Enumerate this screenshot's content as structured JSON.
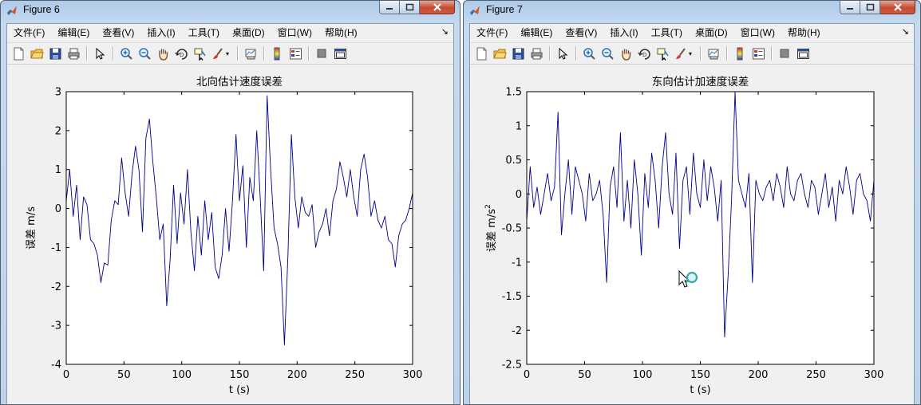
{
  "windows": [
    {
      "title": "Figure 6",
      "menu": [
        "文件(F)",
        "编辑(E)",
        "查看(V)",
        "插入(I)",
        "工具(T)",
        "桌面(D)",
        "窗口(W)",
        "帮助(H)"
      ],
      "menu_overflow_icon": "chevron-icon"
    },
    {
      "title": "Figure 7",
      "menu": [
        "文件(F)",
        "编辑(E)",
        "查看(V)",
        "插入(I)",
        "工具(T)",
        "桌面(D)",
        "窗口(W)",
        "帮助(H)"
      ],
      "menu_overflow_icon": "chevron-icon"
    }
  ],
  "toolbar_icons": [
    "new-figure-icon",
    "open-file-icon",
    "save-icon",
    "print-icon",
    "edit-plot-arrow-icon",
    "zoom-in-icon",
    "zoom-out-icon",
    "pan-hand-icon",
    "rotate-3d-icon",
    "data-cursor-icon",
    "brush-icon",
    "link-plot-icon",
    "colorbar-icon",
    "legend-icon",
    "hide-plot-tools-icon",
    "show-plot-tools-icon"
  ],
  "colors": {
    "line": "#00008b",
    "figure_bg": "#f0f0f0",
    "axes_bg": "#ffffff"
  },
  "chart_data": [
    {
      "type": "line",
      "title": "北向估计速度误差",
      "xlabel": "t (s)",
      "ylabel": "误差 m/s",
      "xlim": [
        0,
        300
      ],
      "ylim": [
        -4,
        3
      ],
      "xticks": [
        "0",
        "50",
        "100",
        "150",
        "200",
        "250",
        "300"
      ],
      "yticks": [
        "-4",
        "-3",
        "-2",
        "-1",
        "0",
        "1",
        "2",
        "3"
      ],
      "grid": false,
      "x": [
        0,
        3,
        6,
        9,
        12,
        15,
        18,
        21,
        24,
        27,
        30,
        33,
        36,
        39,
        42,
        45,
        48,
        51,
        54,
        57,
        60,
        63,
        66,
        69,
        72,
        75,
        78,
        81,
        84,
        87,
        90,
        93,
        96,
        99,
        102,
        105,
        108,
        111,
        114,
        117,
        120,
        123,
        126,
        129,
        132,
        135,
        138,
        141,
        144,
        147,
        150,
        153,
        156,
        159,
        162,
        165,
        168,
        171,
        174,
        177,
        180,
        183,
        186,
        189,
        192,
        195,
        198,
        201,
        204,
        207,
        210,
        213,
        216,
        219,
        222,
        225,
        228,
        231,
        234,
        237,
        240,
        243,
        246,
        249,
        252,
        255,
        258,
        261,
        264,
        267,
        270,
        273,
        276,
        279,
        282,
        285,
        288,
        291,
        294,
        297,
        300
      ],
      "y": [
        0.2,
        1.0,
        -0.2,
        0.6,
        -0.8,
        0.3,
        0.1,
        -0.8,
        -0.9,
        -1.2,
        -1.9,
        -1.4,
        -1.45,
        -0.3,
        0.2,
        0.1,
        1.3,
        0.4,
        -0.2,
        0.9,
        1.6,
        1.0,
        -0.6,
        1.8,
        2.3,
        1.2,
        0.3,
        -0.8,
        -0.4,
        -2.5,
        -1.3,
        0.6,
        -0.9,
        0.4,
        -0.4,
        1.0,
        -0.6,
        -1.6,
        -0.2,
        -1.2,
        0.2,
        -0.8,
        -0.1,
        -1.5,
        -1.8,
        -1.2,
        0.0,
        -1.1,
        0.2,
        1.9,
        0.2,
        1.1,
        -1.0,
        0.8,
        0.2,
        2.0,
        0.3,
        -1.6,
        2.9,
        1.0,
        -0.5,
        -0.9,
        -1.5,
        -3.5,
        -1.2,
        1.9,
        0.3,
        -0.5,
        0.3,
        -0.1,
        -0.2,
        0.1,
        -1.0,
        -0.6,
        -0.4,
        0.0,
        -0.7,
        0.2,
        0.5,
        1.2,
        0.8,
        0.3,
        1.0,
        0.3,
        -0.2,
        1.0,
        1.4,
        0.8,
        -0.2,
        0.2,
        -0.3,
        -0.5,
        -0.2,
        -0.8,
        -0.9,
        -1.5,
        -0.7,
        -0.4,
        -0.3,
        0.0,
        0.4
      ],
      "series_color": "#00008b"
    },
    {
      "type": "line",
      "title": "东向估计加速度误差",
      "xlabel": "t (s)",
      "ylabel": "误差 m/s",
      "ylabel_superscript": "2",
      "xlim": [
        0,
        300
      ],
      "ylim": [
        -2.5,
        1.5
      ],
      "xticks": [
        "0",
        "50",
        "100",
        "150",
        "200",
        "250",
        "300"
      ],
      "yticks": [
        "-2.5",
        "-2",
        "-1.5",
        "-1",
        "-0.5",
        "0",
        "0.5",
        "1",
        "1.5"
      ],
      "grid": false,
      "x": [
        0,
        3,
        6,
        9,
        12,
        15,
        18,
        21,
        24,
        27,
        30,
        33,
        36,
        39,
        42,
        45,
        48,
        51,
        54,
        57,
        60,
        63,
        66,
        69,
        72,
        75,
        78,
        81,
        84,
        87,
        90,
        93,
        96,
        99,
        102,
        105,
        108,
        111,
        114,
        117,
        120,
        123,
        126,
        129,
        132,
        135,
        138,
        141,
        144,
        147,
        150,
        153,
        156,
        159,
        162,
        165,
        168,
        171,
        174,
        177,
        180,
        183,
        186,
        189,
        192,
        195,
        198,
        201,
        204,
        207,
        210,
        213,
        216,
        219,
        222,
        225,
        228,
        231,
        234,
        237,
        240,
        243,
        246,
        249,
        252,
        255,
        258,
        261,
        264,
        267,
        270,
        273,
        276,
        279,
        282,
        285,
        288,
        291,
        294,
        297,
        300
      ],
      "y": [
        -0.4,
        0.4,
        -0.2,
        0.1,
        -0.3,
        0.0,
        0.3,
        -0.1,
        0.1,
        1.2,
        -0.6,
        0.0,
        0.5,
        -0.3,
        0.4,
        0.2,
        0.0,
        -0.4,
        0.3,
        -0.1,
        0.0,
        0.2,
        -0.3,
        -1.3,
        0.1,
        0.4,
        -0.2,
        0.9,
        -0.4,
        0.2,
        -0.5,
        0.5,
        0.0,
        -0.9,
        0.3,
        -0.2,
        0.6,
        0.2,
        -0.5,
        0.4,
        0.9,
        0.0,
        -0.3,
        0.6,
        -0.8,
        0.2,
        0.4,
        -0.3,
        0.6,
        0.0,
        -0.2,
        0.5,
        -0.1,
        0.4,
        0.1,
        -0.4,
        0.2,
        -2.1,
        -1.2,
        -0.1,
        1.5,
        0.2,
        0.0,
        -0.2,
        0.3,
        -1.3,
        0.2,
        0.0,
        -0.1,
        0.1,
        0.2,
        -0.1,
        0.3,
        0.1,
        -0.2,
        0.4,
        0.0,
        -0.1,
        0.2,
        0.3,
        0.0,
        -0.2,
        0.2,
        0.1,
        -0.3,
        0.0,
        0.3,
        -0.2,
        0.1,
        -0.4,
        0.2,
        0.0,
        0.4,
        0.1,
        -0.3,
        0.2,
        0.3,
        0.0,
        -0.1,
        -0.4,
        0.2
      ],
      "series_color": "#00008b"
    }
  ],
  "cursor_icon": "zoom-cursor-icon"
}
